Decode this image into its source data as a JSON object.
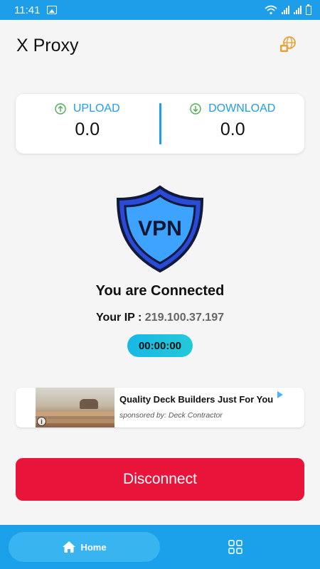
{
  "status_bar": {
    "time": "11:41",
    "icons": [
      "gallery-icon",
      "wifi-icon",
      "signal-icon",
      "signal-icon",
      "battery-icon"
    ]
  },
  "app": {
    "title": "X Proxy",
    "header_icon": "globe-icon"
  },
  "stats": {
    "upload_label": "UPLOAD",
    "upload_value": "0.0",
    "download_label": "DOWNLOAD",
    "download_value": "0.0"
  },
  "shield": {
    "text": "VPN"
  },
  "connection": {
    "status": "You are Connected",
    "ip_label": "Your IP :",
    "ip_value": "219.100.37.197",
    "timer": "00:00:00"
  },
  "ad": {
    "title": "Quality Deck Builders Just For You",
    "sponsor": "sponsored by: Deck Contractor",
    "info_glyph": "i"
  },
  "actions": {
    "disconnect_label": "Disconnect"
  },
  "nav": {
    "home_label": "Home"
  },
  "colors": {
    "accent": "#1e9ee8",
    "disconnect": "#e8143a",
    "nav": "#1ba1ea",
    "shield_fill": "#2b8ff0",
    "shield_border": "#1a2a5c"
  }
}
